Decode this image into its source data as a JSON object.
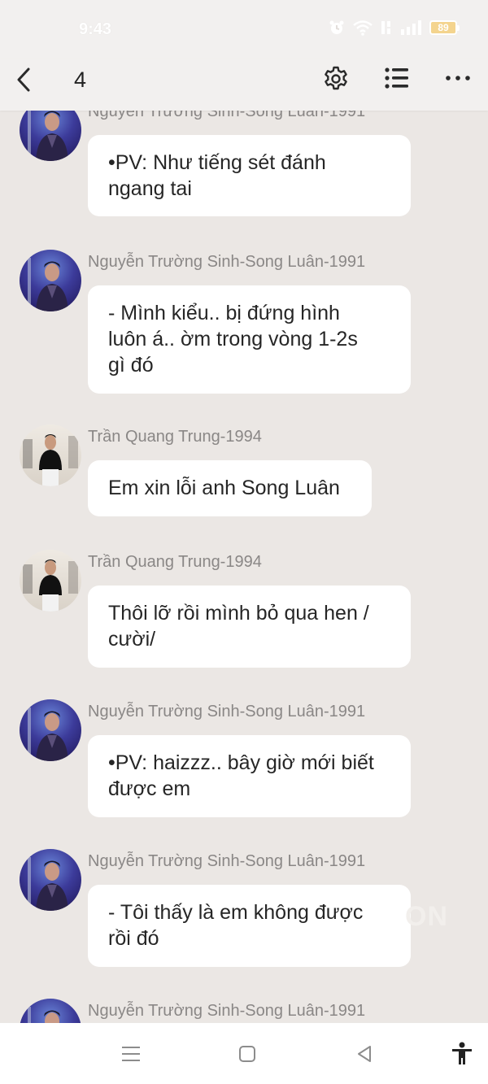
{
  "status_bar": {
    "time": "9:43",
    "battery": "89",
    "icons": [
      "alarm-icon",
      "wifi-icon",
      "volte-icon",
      "signal-icon",
      "battery-icon"
    ]
  },
  "header": {
    "chapter": "4",
    "icons": [
      "back-arrow-icon",
      "gear-icon",
      "list-icon",
      "more-dots-icon"
    ]
  },
  "messages": [
    {
      "sender": "Nguyễn Trường Sinh-Song Luân-1991",
      "text": "•PV: Như tiếng sét đánh\nngang tai",
      "avatar": "song-luan-avatar"
    },
    {
      "sender": "Nguyễn Trường Sinh-Song Luân-1991",
      "text": "- Mình kiểu.. bị đứng hình\nluôn á.. ờm trong vòng 1-2s\ngì đó",
      "avatar": "song-luan-avatar"
    },
    {
      "sender": "Trần Quang Trung-1994",
      "text": "Em xin lỗi anh Song Luân",
      "avatar": "quang-trung-avatar"
    },
    {
      "sender": "Trần Quang Trung-1994",
      "text": "Thôi lỡ rồi mình bỏ qua hen /\ncười/",
      "avatar": "quang-trung-avatar"
    },
    {
      "sender": "Nguyễn Trường Sinh-Song Luân-1991",
      "text": "•PV: haizzz.. bây giờ mới biết\nđược em",
      "avatar": "song-luan-avatar"
    },
    {
      "sender": "Nguyễn Trường Sinh-Song Luân-1991",
      "text": "- Tôi thấy là em không được\nrồi đó",
      "avatar": "song-luan-avatar"
    },
    {
      "sender": "Nguyễn Trường Sinh-Song Luân-1991",
      "text": "",
      "avatar": "song-luan-avatar"
    }
  ],
  "watermark": "ON",
  "colors": {
    "background": "#ebe7e4",
    "bubble": "#ffffff",
    "sender_name": "#8a8786",
    "message_text": "#262626"
  },
  "nav_bar": {
    "icons": [
      "menu-icon",
      "home-square-icon",
      "back-triangle-icon",
      "accessibility-icon"
    ]
  }
}
